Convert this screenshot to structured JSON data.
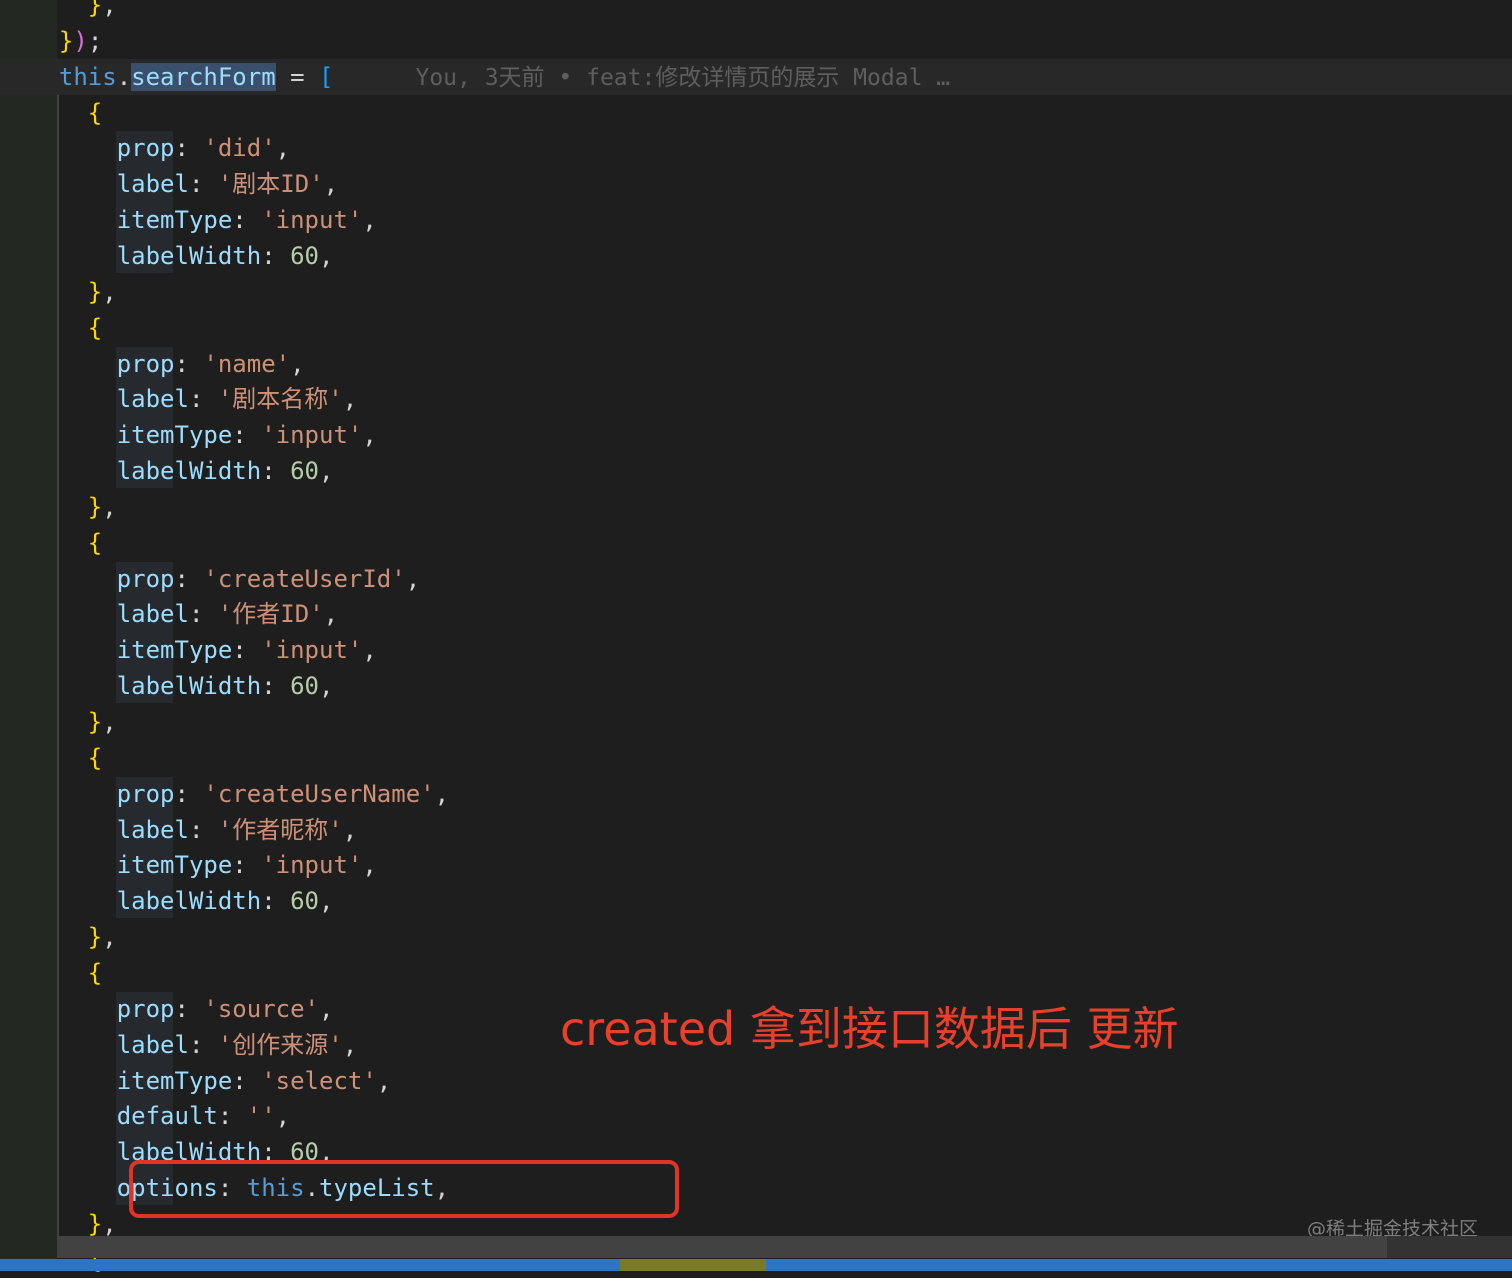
{
  "editor": {
    "lines": [
      {
        "id": "l0",
        "tokens": [
          {
            "t": "    ",
            "c": "punc"
          },
          {
            "t": "}",
            "c": "brace"
          },
          {
            "t": ",",
            "c": "punc"
          }
        ]
      },
      {
        "id": "l1",
        "tokens": [
          {
            "t": "  ",
            "c": "punc"
          },
          {
            "t": "}",
            "c": "brace"
          },
          {
            "t": ")",
            "c": "paren"
          },
          {
            "t": ";",
            "c": "punc"
          }
        ]
      },
      {
        "id": "l2",
        "current": true,
        "tokens": [
          {
            "t": "  ",
            "c": "punc"
          },
          {
            "t": "this",
            "c": "kw"
          },
          {
            "t": ".",
            "c": "punc"
          },
          {
            "t": "searchForm",
            "c": "sel"
          },
          {
            "t": " = ",
            "c": "punc"
          },
          {
            "t": "[",
            "c": "bracket"
          }
        ],
        "blame": "You, 3天前 • feat:修改详情页的展示 Modal …"
      },
      {
        "id": "l3",
        "tokens": [
          {
            "t": "    ",
            "c": "punc"
          },
          {
            "t": "{",
            "c": "brace"
          }
        ]
      },
      {
        "id": "l4",
        "tokens": [
          {
            "t": "      ",
            "c": "punc"
          },
          {
            "t": "prop",
            "c": "prop"
          },
          {
            "t": ": ",
            "c": "punc"
          },
          {
            "t": "'did'",
            "c": "str"
          },
          {
            "t": ",",
            "c": "punc"
          }
        ]
      },
      {
        "id": "l5",
        "tokens": [
          {
            "t": "      ",
            "c": "punc"
          },
          {
            "t": "label",
            "c": "prop"
          },
          {
            "t": ": ",
            "c": "punc"
          },
          {
            "t": "'剧本ID'",
            "c": "str"
          },
          {
            "t": ",",
            "c": "punc"
          }
        ]
      },
      {
        "id": "l6",
        "tokens": [
          {
            "t": "      ",
            "c": "punc"
          },
          {
            "t": "itemType",
            "c": "prop"
          },
          {
            "t": ": ",
            "c": "punc"
          },
          {
            "t": "'input'",
            "c": "str"
          },
          {
            "t": ",",
            "c": "punc"
          }
        ]
      },
      {
        "id": "l7",
        "tokens": [
          {
            "t": "      ",
            "c": "punc"
          },
          {
            "t": "labelWidth",
            "c": "prop"
          },
          {
            "t": ": ",
            "c": "punc"
          },
          {
            "t": "60",
            "c": "num"
          },
          {
            "t": ",",
            "c": "punc"
          }
        ]
      },
      {
        "id": "l8",
        "tokens": [
          {
            "t": "    ",
            "c": "punc"
          },
          {
            "t": "}",
            "c": "brace"
          },
          {
            "t": ",",
            "c": "punc"
          }
        ]
      },
      {
        "id": "l9",
        "tokens": [
          {
            "t": "    ",
            "c": "punc"
          },
          {
            "t": "{",
            "c": "brace"
          }
        ]
      },
      {
        "id": "l10",
        "tokens": [
          {
            "t": "      ",
            "c": "punc"
          },
          {
            "t": "prop",
            "c": "prop"
          },
          {
            "t": ": ",
            "c": "punc"
          },
          {
            "t": "'name'",
            "c": "str"
          },
          {
            "t": ",",
            "c": "punc"
          }
        ]
      },
      {
        "id": "l11",
        "tokens": [
          {
            "t": "      ",
            "c": "punc"
          },
          {
            "t": "label",
            "c": "prop"
          },
          {
            "t": ": ",
            "c": "punc"
          },
          {
            "t": "'剧本名称'",
            "c": "str"
          },
          {
            "t": ",",
            "c": "punc"
          }
        ]
      },
      {
        "id": "l12",
        "tokens": [
          {
            "t": "      ",
            "c": "punc"
          },
          {
            "t": "itemType",
            "c": "prop"
          },
          {
            "t": ": ",
            "c": "punc"
          },
          {
            "t": "'input'",
            "c": "str"
          },
          {
            "t": ",",
            "c": "punc"
          }
        ]
      },
      {
        "id": "l13",
        "tokens": [
          {
            "t": "      ",
            "c": "punc"
          },
          {
            "t": "labelWidth",
            "c": "prop"
          },
          {
            "t": ": ",
            "c": "punc"
          },
          {
            "t": "60",
            "c": "num"
          },
          {
            "t": ",",
            "c": "punc"
          }
        ]
      },
      {
        "id": "l14",
        "tokens": [
          {
            "t": "    ",
            "c": "punc"
          },
          {
            "t": "}",
            "c": "brace"
          },
          {
            "t": ",",
            "c": "punc"
          }
        ]
      },
      {
        "id": "l15",
        "tokens": [
          {
            "t": "    ",
            "c": "punc"
          },
          {
            "t": "{",
            "c": "brace"
          }
        ]
      },
      {
        "id": "l16",
        "tokens": [
          {
            "t": "      ",
            "c": "punc"
          },
          {
            "t": "prop",
            "c": "prop"
          },
          {
            "t": ": ",
            "c": "punc"
          },
          {
            "t": "'createUserId'",
            "c": "str"
          },
          {
            "t": ",",
            "c": "punc"
          }
        ]
      },
      {
        "id": "l17",
        "tokens": [
          {
            "t": "      ",
            "c": "punc"
          },
          {
            "t": "label",
            "c": "prop"
          },
          {
            "t": ": ",
            "c": "punc"
          },
          {
            "t": "'作者ID'",
            "c": "str"
          },
          {
            "t": ",",
            "c": "punc"
          }
        ]
      },
      {
        "id": "l18",
        "tokens": [
          {
            "t": "      ",
            "c": "punc"
          },
          {
            "t": "itemType",
            "c": "prop"
          },
          {
            "t": ": ",
            "c": "punc"
          },
          {
            "t": "'input'",
            "c": "str"
          },
          {
            "t": ",",
            "c": "punc"
          }
        ]
      },
      {
        "id": "l19",
        "tokens": [
          {
            "t": "      ",
            "c": "punc"
          },
          {
            "t": "labelWidth",
            "c": "prop"
          },
          {
            "t": ": ",
            "c": "punc"
          },
          {
            "t": "60",
            "c": "num"
          },
          {
            "t": ",",
            "c": "punc"
          }
        ]
      },
      {
        "id": "l20",
        "tokens": [
          {
            "t": "    ",
            "c": "punc"
          },
          {
            "t": "}",
            "c": "brace"
          },
          {
            "t": ",",
            "c": "punc"
          }
        ]
      },
      {
        "id": "l21",
        "tokens": [
          {
            "t": "    ",
            "c": "punc"
          },
          {
            "t": "{",
            "c": "brace"
          }
        ]
      },
      {
        "id": "l22",
        "tokens": [
          {
            "t": "      ",
            "c": "punc"
          },
          {
            "t": "prop",
            "c": "prop"
          },
          {
            "t": ": ",
            "c": "punc"
          },
          {
            "t": "'createUserName'",
            "c": "str"
          },
          {
            "t": ",",
            "c": "punc"
          }
        ]
      },
      {
        "id": "l23",
        "tokens": [
          {
            "t": "      ",
            "c": "punc"
          },
          {
            "t": "label",
            "c": "prop"
          },
          {
            "t": ": ",
            "c": "punc"
          },
          {
            "t": "'作者昵称'",
            "c": "str"
          },
          {
            "t": ",",
            "c": "punc"
          }
        ]
      },
      {
        "id": "l24",
        "tokens": [
          {
            "t": "      ",
            "c": "punc"
          },
          {
            "t": "itemType",
            "c": "prop"
          },
          {
            "t": ": ",
            "c": "punc"
          },
          {
            "t": "'input'",
            "c": "str"
          },
          {
            "t": ",",
            "c": "punc"
          }
        ]
      },
      {
        "id": "l25",
        "tokens": [
          {
            "t": "      ",
            "c": "punc"
          },
          {
            "t": "labelWidth",
            "c": "prop"
          },
          {
            "t": ": ",
            "c": "punc"
          },
          {
            "t": "60",
            "c": "num"
          },
          {
            "t": ",",
            "c": "punc"
          }
        ]
      },
      {
        "id": "l26",
        "tokens": [
          {
            "t": "    ",
            "c": "punc"
          },
          {
            "t": "}",
            "c": "brace"
          },
          {
            "t": ",",
            "c": "punc"
          }
        ]
      },
      {
        "id": "l27",
        "tokens": [
          {
            "t": "    ",
            "c": "punc"
          },
          {
            "t": "{",
            "c": "brace"
          }
        ]
      },
      {
        "id": "l28",
        "tokens": [
          {
            "t": "      ",
            "c": "punc"
          },
          {
            "t": "prop",
            "c": "prop"
          },
          {
            "t": ": ",
            "c": "punc"
          },
          {
            "t": "'source'",
            "c": "str"
          },
          {
            "t": ",",
            "c": "punc"
          }
        ]
      },
      {
        "id": "l29",
        "tokens": [
          {
            "t": "      ",
            "c": "punc"
          },
          {
            "t": "label",
            "c": "prop"
          },
          {
            "t": ": ",
            "c": "punc"
          },
          {
            "t": "'创作来源'",
            "c": "str"
          },
          {
            "t": ",",
            "c": "punc"
          }
        ]
      },
      {
        "id": "l30",
        "tokens": [
          {
            "t": "      ",
            "c": "punc"
          },
          {
            "t": "itemType",
            "c": "prop"
          },
          {
            "t": ": ",
            "c": "punc"
          },
          {
            "t": "'select'",
            "c": "str"
          },
          {
            "t": ",",
            "c": "punc"
          }
        ]
      },
      {
        "id": "l31",
        "tokens": [
          {
            "t": "      ",
            "c": "punc"
          },
          {
            "t": "default",
            "c": "prop"
          },
          {
            "t": ": ",
            "c": "punc"
          },
          {
            "t": "''",
            "c": "str"
          },
          {
            "t": ",",
            "c": "punc"
          }
        ]
      },
      {
        "id": "l32",
        "tokens": [
          {
            "t": "      ",
            "c": "punc"
          },
          {
            "t": "labelWidth",
            "c": "prop"
          },
          {
            "t": ": ",
            "c": "punc"
          },
          {
            "t": "60",
            "c": "num"
          },
          {
            "t": ",",
            "c": "punc"
          }
        ]
      },
      {
        "id": "l33",
        "tokens": [
          {
            "t": "      ",
            "c": "punc"
          },
          {
            "t": "options",
            "c": "prop"
          },
          {
            "t": ": ",
            "c": "punc"
          },
          {
            "t": "this",
            "c": "kw"
          },
          {
            "t": ".",
            "c": "punc"
          },
          {
            "t": "typeList",
            "c": "prop"
          },
          {
            "t": ",",
            "c": "punc"
          }
        ]
      },
      {
        "id": "l34",
        "tokens": [
          {
            "t": "    ",
            "c": "punc"
          },
          {
            "t": "}",
            "c": "brace"
          },
          {
            "t": ",",
            "c": "punc"
          }
        ]
      },
      {
        "id": "l35",
        "tokens": [
          {
            "t": "    ",
            "c": "punc"
          },
          {
            "t": "{",
            "c": "brace"
          }
        ]
      }
    ]
  },
  "annotation": {
    "text": "created 拿到接口数据后 更新",
    "color": "#e8402a"
  },
  "watermark": "@稀土掘金技术社区",
  "colors": {
    "background": "#1e1e1e",
    "statusbar": "#2b76c4",
    "annotation_box": "#e03524"
  }
}
